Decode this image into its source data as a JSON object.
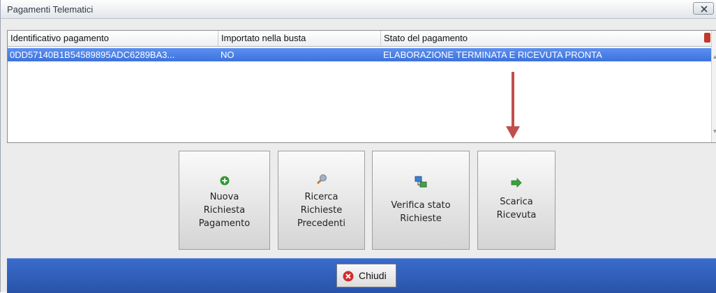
{
  "window": {
    "title": "Pagamenti Telematici",
    "close_icon": "close-icon"
  },
  "table": {
    "columns": [
      "Identificativo pagamento",
      "Importato nella busta",
      "Stato del pagamento"
    ],
    "rows": [
      [
        "0DD57140B1B54589895ADC6289BA3...",
        "NO",
        "ELABORAZIONE TERMINATA E RICEVUTA PRONTA"
      ]
    ],
    "selected_row": 0
  },
  "buttons": [
    {
      "label_lines": [
        "Nuova",
        "Richiesta",
        "Pagamento"
      ],
      "icon": "plus-circle-icon"
    },
    {
      "label_lines": [
        "Ricerca",
        "Richieste",
        "Precedenti"
      ],
      "icon": "search-icon"
    },
    {
      "label_lines": [
        "Verifica stato",
        "Richieste"
      ],
      "icon": "network-icon"
    },
    {
      "label_lines": [
        "Scarica",
        "Ricevuta"
      ],
      "icon": "download-arrow-icon"
    }
  ],
  "footer": {
    "close_label": "Chiudi",
    "close_icon": "close-circle-icon"
  },
  "colors": {
    "selection": "#3d73dc",
    "footer": "#2853a9",
    "annotation_arrow": "#c0504d"
  }
}
